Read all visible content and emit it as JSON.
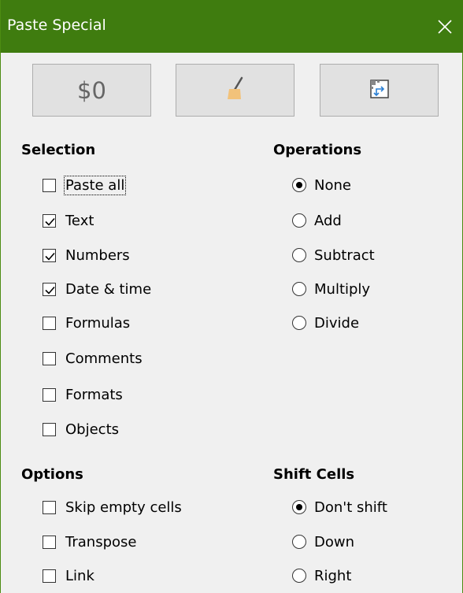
{
  "dialog": {
    "title": "Paste Special",
    "close_icon": "close-icon"
  },
  "presets": {
    "values_only_label": "$0",
    "formats_only_icon": "paintbrush-icon",
    "transpose_icon": "transpose-icon"
  },
  "selection": {
    "header": "Selection",
    "items": [
      {
        "label": "Paste all",
        "checked": false
      },
      {
        "label": "Text",
        "checked": true
      },
      {
        "label": "Numbers",
        "checked": true
      },
      {
        "label": "Date & time",
        "checked": true
      },
      {
        "label": "Formulas",
        "checked": false
      },
      {
        "label": "Comments",
        "checked": false
      },
      {
        "label": "Formats",
        "checked": false
      },
      {
        "label": "Objects",
        "checked": false
      }
    ]
  },
  "operations": {
    "header": "Operations",
    "selected": "None",
    "items": [
      {
        "label": "None"
      },
      {
        "label": "Add"
      },
      {
        "label": "Subtract"
      },
      {
        "label": "Multiply"
      },
      {
        "label": "Divide"
      }
    ]
  },
  "options": {
    "header": "Options",
    "items": [
      {
        "label": "Skip empty cells",
        "checked": false
      },
      {
        "label": "Transpose",
        "checked": false
      },
      {
        "label": "Link",
        "checked": false
      }
    ]
  },
  "shift_cells": {
    "header": "Shift Cells",
    "selected": "Don't shift",
    "items": [
      {
        "label": "Don't shift"
      },
      {
        "label": "Down"
      },
      {
        "label": "Right"
      }
    ]
  },
  "colors": {
    "titlebar": "#3f7c0f",
    "window_bg": "#f0f0f0",
    "button_bg": "#e1e1e1",
    "brush": "#f2c27a"
  }
}
